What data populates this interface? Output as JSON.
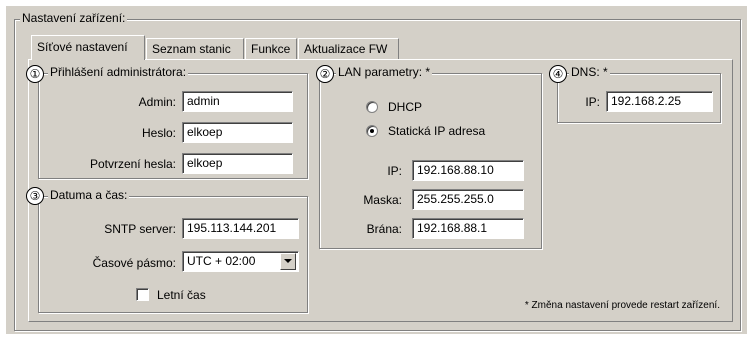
{
  "outer_group": {
    "title": "Nastavení zařízení:"
  },
  "tabs": [
    {
      "label": "Síťové nastavení",
      "active": true
    },
    {
      "label": "Seznam stanic",
      "active": false
    },
    {
      "label": "Funkce",
      "active": false
    },
    {
      "label": "Aktualizace FW",
      "active": false
    }
  ],
  "admin": {
    "marker": "①",
    "title": "Přihlášení administrátora:",
    "admin_label": "Admin:",
    "admin_value": "admin",
    "password_label": "Heslo:",
    "password_value": "elkoep",
    "confirm_label": "Potvrzení hesla:",
    "confirm_value": "elkoep"
  },
  "lan": {
    "marker": "②",
    "title": "LAN parametry: *",
    "dhcp_label": "DHCP",
    "dhcp_selected": false,
    "static_label": "Statická IP adresa",
    "static_selected": true,
    "ip_label": "IP:",
    "ip_value": "192.168.88.10",
    "mask_label": "Maska:",
    "mask_value": "255.255.255.0",
    "gateway_label": "Brána:",
    "gateway_value": "192.168.88.1"
  },
  "datetime": {
    "marker": "③",
    "title": "Datuma a čas:",
    "sntp_label": "SNTP server:",
    "sntp_value": "195.113.144.201",
    "tz_label": "Časové pásmo:",
    "tz_value": "UTC + 02:00",
    "dst_label": "Letní čas",
    "dst_checked": false
  },
  "dns": {
    "marker": "④",
    "title": "DNS: *",
    "ip_label": "IP:",
    "ip_value": "192.168.2.25"
  },
  "footnote": "* Změna nastavení provede restart zařízení."
}
